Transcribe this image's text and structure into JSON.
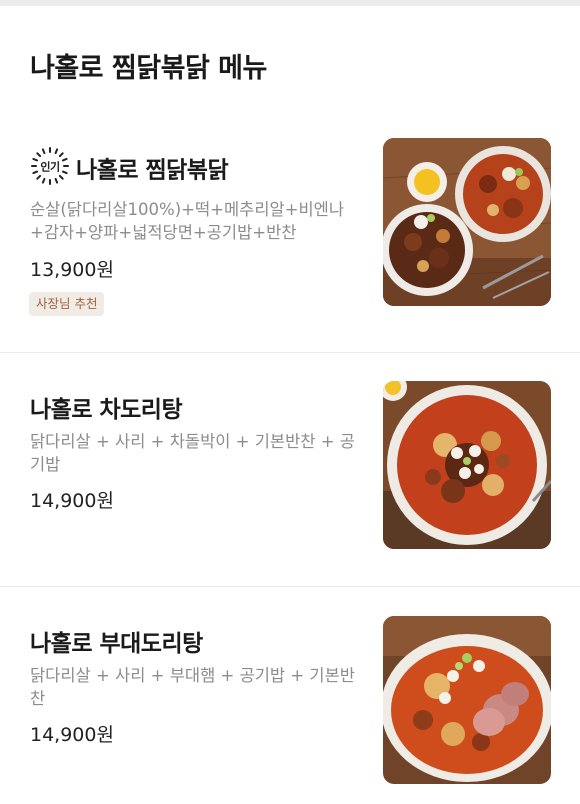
{
  "page": {
    "title": "나홀로 찜닭볶닭 메뉴"
  },
  "items": [
    {
      "badge": "인기",
      "name": "나홀로 찜닭볶닭",
      "description": "순살(닭다리살100%)+떡+메추리알+비엔나+감자+양파+넓적당면+공기밥+반찬",
      "price": "13,900원",
      "tag": "사장님 추천",
      "image_icon": "braised-chicken-dish"
    },
    {
      "name": "나홀로 차도리탕",
      "description": "닭다리살 + 사리 + 차돌박이 + 기본반찬 + 공기밥",
      "price": "14,900원",
      "image_icon": "chicken-stew-dish"
    },
    {
      "name": "나홀로 부대도리탕",
      "description": "닭다리살 + 사리 + 부대햄 + 공기밥 + 기본반찬",
      "price": "14,900원",
      "image_icon": "sausage-chicken-stew-dish"
    }
  ],
  "colors": {
    "tag_background": "#f1ebe6",
    "tag_text": "#a0643f",
    "description_text": "#8c8c8c",
    "divider": "#ebebeb"
  }
}
